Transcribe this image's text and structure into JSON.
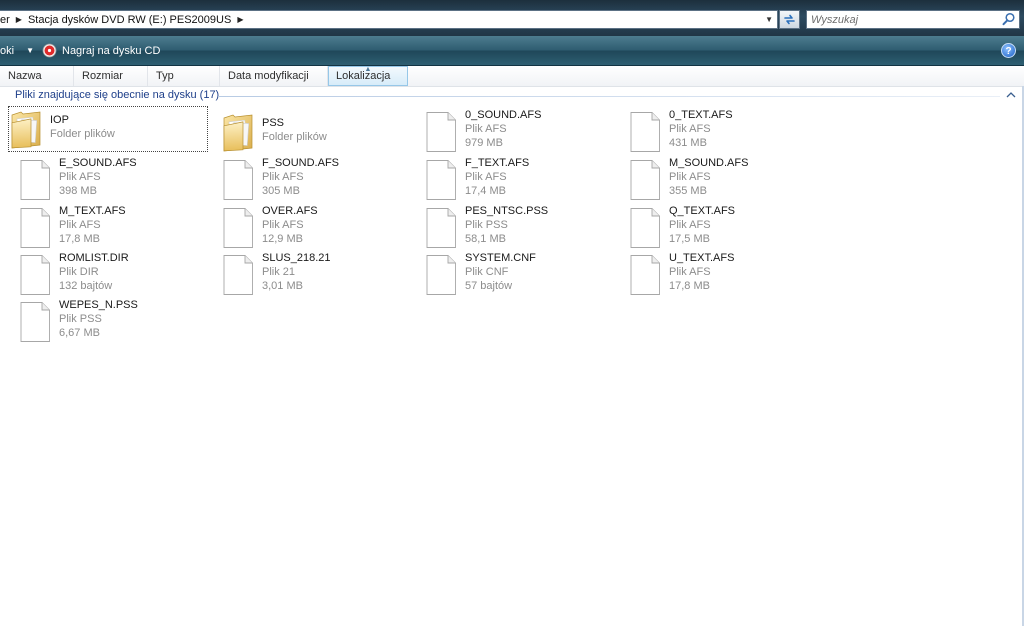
{
  "address_bar": {
    "segments": [
      "er",
      "Stacja dysków DVD RW (E:) PES2009US"
    ],
    "search_placeholder": "Wyszukaj"
  },
  "command_bar": {
    "partial_item": "oki",
    "burn_label": "Nagraj na dysku CD",
    "help_glyph": "?"
  },
  "columns": [
    {
      "label": "Nazwa"
    },
    {
      "label": "Rozmiar"
    },
    {
      "label": "Typ"
    },
    {
      "label": "Data modyfikacji"
    },
    {
      "label": "Lokalizacja",
      "sorted": true
    }
  ],
  "group": {
    "title": "Pliki znajdujące się obecnie na dysku (17)"
  },
  "items": [
    {
      "name": "IOP",
      "type": "Folder plików",
      "size": "",
      "kind": "folder",
      "selected": true
    },
    {
      "name": "PSS",
      "type": "Folder plików",
      "size": "",
      "kind": "folder"
    },
    {
      "name": "0_SOUND.AFS",
      "type": "Plik AFS",
      "size": "979 MB",
      "kind": "file"
    },
    {
      "name": "0_TEXT.AFS",
      "type": "Plik AFS",
      "size": "431 MB",
      "kind": "file"
    },
    {
      "name": "E_SOUND.AFS",
      "type": "Plik AFS",
      "size": "398 MB",
      "kind": "file"
    },
    {
      "name": "F_SOUND.AFS",
      "type": "Plik AFS",
      "size": "305 MB",
      "kind": "file"
    },
    {
      "name": "F_TEXT.AFS",
      "type": "Plik AFS",
      "size": "17,4 MB",
      "kind": "file"
    },
    {
      "name": "M_SOUND.AFS",
      "type": "Plik AFS",
      "size": "355 MB",
      "kind": "file"
    },
    {
      "name": "M_TEXT.AFS",
      "type": "Plik AFS",
      "size": "17,8 MB",
      "kind": "file"
    },
    {
      "name": "OVER.AFS",
      "type": "Plik AFS",
      "size": "12,9 MB",
      "kind": "file"
    },
    {
      "name": "PES_NTSC.PSS",
      "type": "Plik PSS",
      "size": "58,1 MB",
      "kind": "file"
    },
    {
      "name": "Q_TEXT.AFS",
      "type": "Plik AFS",
      "size": "17,5 MB",
      "kind": "file"
    },
    {
      "name": "ROMLIST.DIR",
      "type": "Plik DIR",
      "size": "132 bajtów",
      "kind": "file"
    },
    {
      "name": "SLUS_218.21",
      "type": "Plik 21",
      "size": "3,01 MB",
      "kind": "file"
    },
    {
      "name": "SYSTEM.CNF",
      "type": "Plik CNF",
      "size": "57 bajtów",
      "kind": "file"
    },
    {
      "name": "U_TEXT.AFS",
      "type": "Plik AFS",
      "size": "17,8 MB",
      "kind": "file"
    },
    {
      "name": "WEPES_N.PSS",
      "type": "Plik PSS",
      "size": "6,67 MB",
      "kind": "file"
    }
  ],
  "icons": {
    "folder": "folder-icon",
    "file": "document-icon",
    "burn": "burn-disc-icon",
    "search": "search-icon",
    "refresh": "refresh-icon",
    "help": "help-icon"
  }
}
